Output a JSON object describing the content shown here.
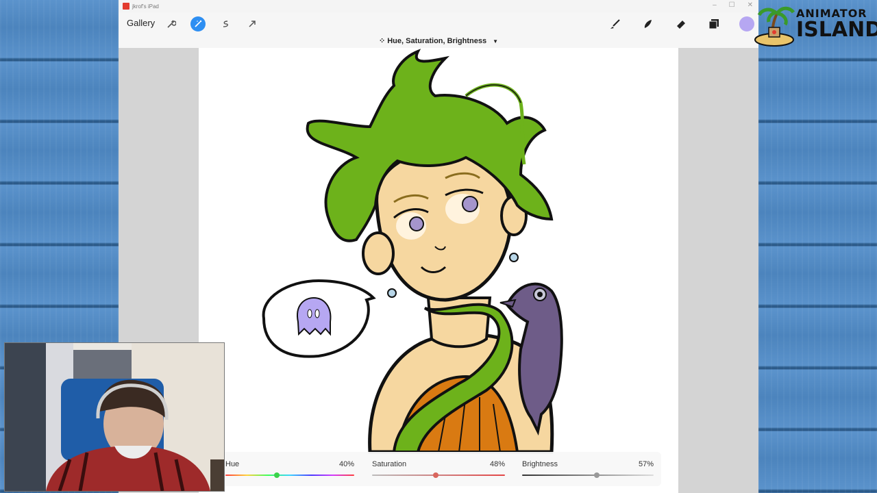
{
  "window": {
    "title": "jkrof's iPad"
  },
  "toolbar": {
    "gallery_label": "Gallery",
    "left_icons": [
      "wrench-icon",
      "magic-wand-icon",
      "selection-icon",
      "transform-arrow-icon"
    ],
    "right_icons": [
      "brush-icon",
      "smudge-icon",
      "eraser-icon",
      "layers-icon"
    ],
    "current_color": "#b6a7f2"
  },
  "adjustment": {
    "title": "Hue, Saturation, Brightness"
  },
  "sliders": {
    "hue": {
      "label": "Hue",
      "value_text": "40%",
      "value": 0.4
    },
    "saturation": {
      "label": "Saturation",
      "value_text": "48%",
      "value": 0.48
    },
    "brightness": {
      "label": "Brightness",
      "value_text": "57%",
      "value": 0.57
    }
  },
  "logo": {
    "line1": "ANIMATOR",
    "line2": "ISLAND"
  },
  "colors": {
    "accent": "#2e8ff2",
    "hair": "#6db21b",
    "skin": "#f6d7a0",
    "shirt": "#d97a12",
    "crow": "#6e5c88",
    "ghost": "#b6a7f2"
  }
}
